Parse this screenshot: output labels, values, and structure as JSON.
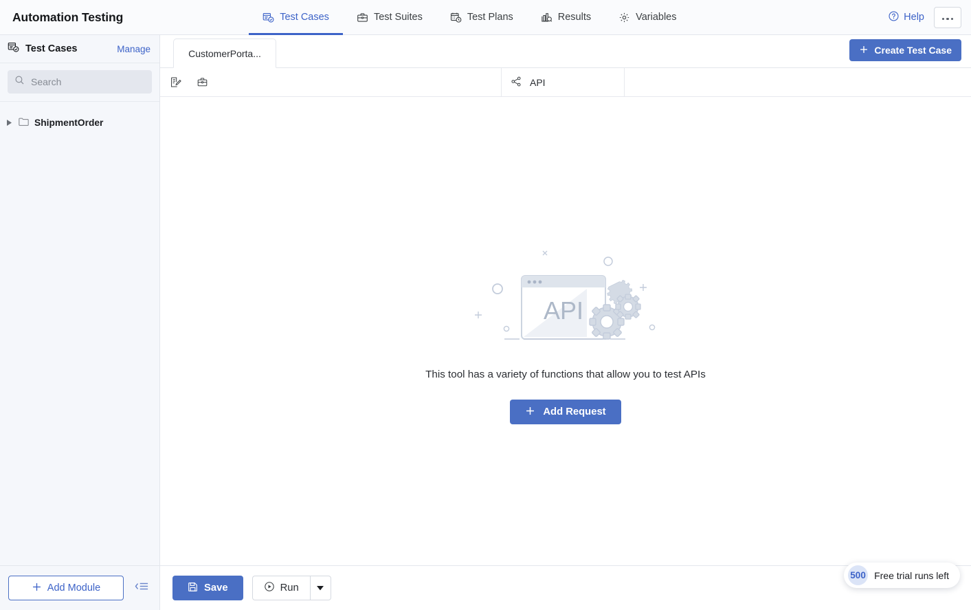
{
  "header": {
    "app_title": "Automation Testing",
    "tabs": [
      {
        "label": "Test Cases",
        "icon": "test-cases-icon",
        "active": true
      },
      {
        "label": "Test Suites",
        "icon": "briefcase-icon",
        "active": false
      },
      {
        "label": "Test Plans",
        "icon": "calendar-clock-icon",
        "active": false
      },
      {
        "label": "Results",
        "icon": "bar-chart-search-icon",
        "active": false
      },
      {
        "label": "Variables",
        "icon": "gear-icon",
        "active": false
      }
    ],
    "help_label": "Help",
    "help_icon": "question-circle-icon",
    "more_icon": "ellipsis-icon"
  },
  "sidebar": {
    "title": "Test Cases",
    "title_icon": "test-cases-icon",
    "manage_label": "Manage",
    "search": {
      "placeholder": "Search",
      "value": "",
      "icon": "search-icon"
    },
    "tree": [
      {
        "label": "ShipmentOrder",
        "icon": "folder-icon",
        "caret": "caret-right-icon",
        "expanded": false
      }
    ],
    "footer": {
      "add_module_label": "Add Module",
      "add_module_icon": "plus-icon",
      "collapse_icon": "collapse-panel-icon"
    }
  },
  "main": {
    "doc_tab_label": "CustomerPorta...",
    "create_test_case_label": "Create Test Case",
    "create_test_case_icon": "plus-icon",
    "subtoolbar": {
      "icons": [
        {
          "name": "edit-document-icon"
        },
        {
          "name": "briefcase-icon"
        }
      ],
      "api_label": "API",
      "api_icon": "share-nodes-icon"
    },
    "empty_state": {
      "illustration_label": "API",
      "message": "This tool has a variety of functions that allow you to test APIs",
      "add_request_label": "Add Request",
      "add_request_icon": "plus-icon"
    }
  },
  "bottombar": {
    "save_label": "Save",
    "save_icon": "floppy-disk-icon",
    "run_label": "Run",
    "run_icon": "play-circle-icon",
    "run_caret_icon": "caret-down-icon",
    "trial": {
      "count": "500",
      "label": "Free trial runs left"
    }
  },
  "colors": {
    "accent_blue": "#4a6fc4",
    "link_blue": "#3d63c8",
    "sidebar_bg": "#f5f7fb",
    "topbar_bg": "#fafbfd",
    "border": "#e3e6ec",
    "illustration": "#ccd4e0"
  }
}
